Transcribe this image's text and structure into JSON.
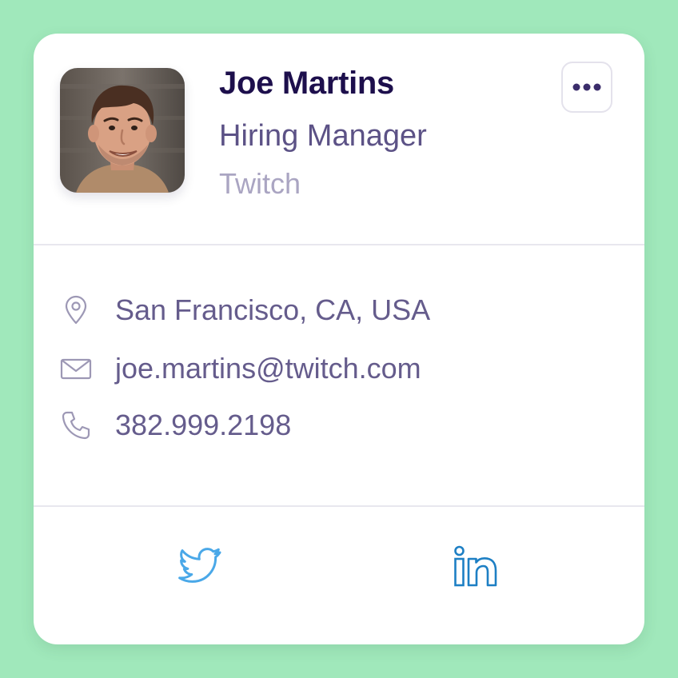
{
  "profile": {
    "name": "Joe Martins",
    "title": "Hiring Manager",
    "company": "Twitch",
    "avatar_icon": "profile-photo"
  },
  "menu": {
    "icon": "more-horizontal-icon"
  },
  "contact": {
    "location": "San Francisco, CA, USA",
    "email": "joe.martins@twitch.com",
    "phone": "382.999.2198"
  },
  "social": {
    "twitter_icon": "twitter-icon",
    "linkedin_icon": "linkedin-icon"
  },
  "colors": {
    "background": "#a0e8bb",
    "card": "#ffffff",
    "name": "#1d0f4c",
    "title": "#5c5286",
    "company": "#aaa5c2",
    "contact_text": "#655c8c",
    "twitter": "#4aa8e8",
    "linkedin": "#1d7fc4"
  }
}
